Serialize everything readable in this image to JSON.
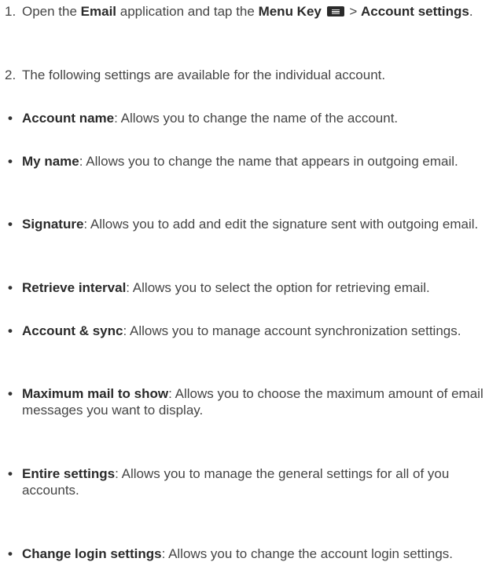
{
  "steps": [
    {
      "num": "1.",
      "parts": [
        "Open the ",
        "Email",
        " application and tap the ",
        "Menu Key",
        " > ",
        "Account settings",
        "."
      ]
    },
    {
      "num": "2.",
      "text": "The following settings are available for the individual account."
    }
  ],
  "icons": {
    "menu_key": "menu-key-icon"
  },
  "items": [
    {
      "term": "Account name",
      "desc": ": Allows you to change the name of the account."
    },
    {
      "term": "My name",
      "desc": ": Allows you to change the name that appears in outgoing email."
    },
    {
      "term": "Signature",
      "desc": ": Allows you to add and edit the signature sent with outgoing email."
    },
    {
      "term": "Retrieve interval",
      "desc": ": Allows you to select the option for retrieving email."
    },
    {
      "term": "Account & sync",
      "desc": ": Allows you to manage account synchronization settings."
    },
    {
      "term": "Maximum mail to show",
      "desc": ": Allows you to choose the maximum amount of email messages you want to display."
    },
    {
      "term": "Entire settings",
      "desc": ": Allows you to manage the general settings for all of you accounts."
    },
    {
      "term": "Change login settings",
      "desc": ": Allows you to change the account login settings."
    }
  ],
  "bullet": "•"
}
